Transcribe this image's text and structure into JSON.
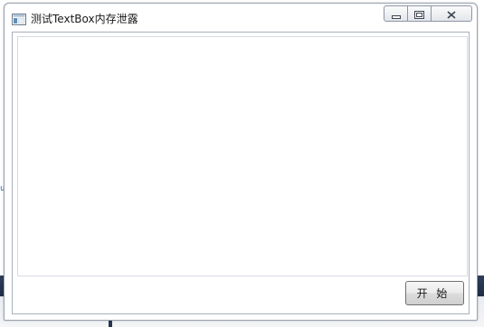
{
  "window": {
    "title": "测试TextBox内存泄露"
  },
  "caption_buttons": {
    "minimize_icon": "minimize-icon",
    "maximize_icon": "maximize-icon",
    "close_icon": "close-icon"
  },
  "main": {
    "textbox_value": "",
    "start_button_label": "开 始"
  },
  "background": {
    "edge_mark": "u"
  },
  "colors": {
    "window_border": "#9aa4b2",
    "button_border": "#707070"
  }
}
